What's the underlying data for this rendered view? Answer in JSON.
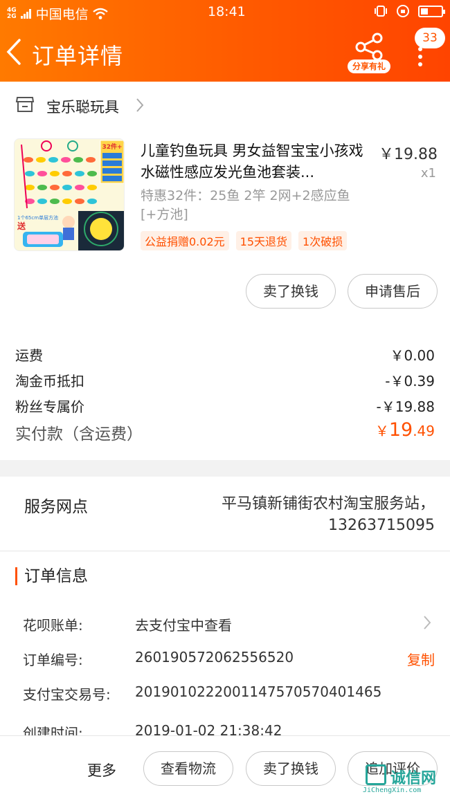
{
  "status_bar": {
    "network": "4G 2G",
    "carrier": "中国电信",
    "time": "18:41"
  },
  "header": {
    "title": "订单详情",
    "share_label": "分享有礼",
    "message_count": "33"
  },
  "shop": {
    "name": "宝乐聪玩具"
  },
  "product": {
    "title": "儿童钓鱼玩具 男女益智宝宝小孩戏水磁性感应发光鱼池套装...",
    "price": "￥19.88",
    "quantity": "x1",
    "sku": "特惠32件：25鱼 2竿 2网+2感应鱼[+方池]",
    "tags": [
      "公益捐赠0.02元",
      "15天退货",
      "1次破损"
    ],
    "image_text": {
      "count": "32件+",
      "promo": "送",
      "pool": "1个65cm单层方池"
    }
  },
  "item_actions": {
    "sell": "卖了换钱",
    "after_sale": "申请售后"
  },
  "fees": [
    {
      "label": "运费",
      "value": "￥0.00"
    },
    {
      "label": "淘金币抵扣",
      "value": "-￥0.39"
    },
    {
      "label": "粉丝专属价",
      "value": "-￥19.88"
    }
  ],
  "total": {
    "label": "实付款（含运费）",
    "currency": "￥",
    "integer": "19",
    "decimal": ".49"
  },
  "service": {
    "label": "服务网点",
    "address_line1": "平马镇新铺街农村淘宝服务站，",
    "address_line2": "13263715095"
  },
  "order_info": {
    "title": "订单信息",
    "rows": [
      {
        "key": "花呗账单:",
        "value": "去支付宝中查看"
      },
      {
        "key": "订单编号:",
        "value": "260190572062556520",
        "action": "复制"
      },
      {
        "key": "支付宝交易号:",
        "value": "2019010222001147570570401465"
      },
      {
        "key": "创建时间:",
        "value": "2019-01-02 21:38:42"
      }
    ]
  },
  "bottom_bar": {
    "more": "更多",
    "logistics": "查看物流",
    "sell": "卖了换钱",
    "review": "追加评价"
  },
  "watermark": {
    "text": "诚信网",
    "sub": "JiChengXin.com"
  },
  "colors": {
    "accent": "#ff5000",
    "header_start": "#ff7a00",
    "header_end": "#ff4400"
  }
}
